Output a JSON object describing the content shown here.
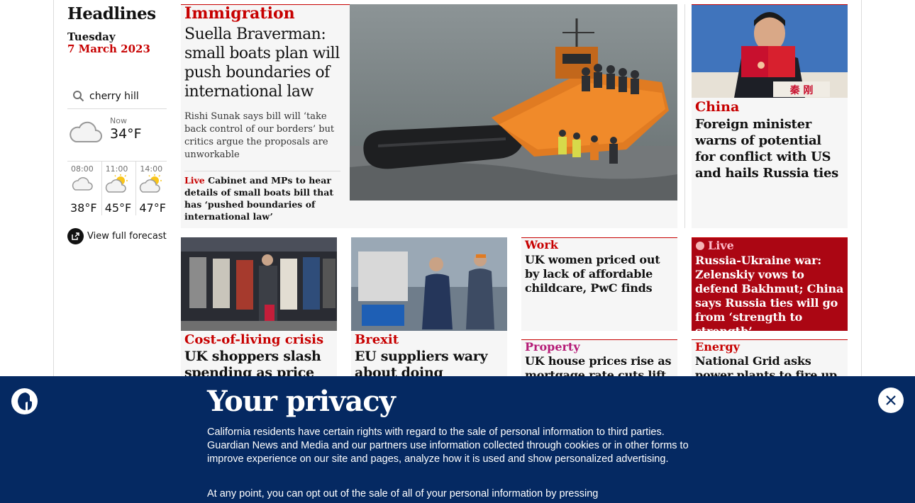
{
  "sidebar": {
    "title": "Headlines",
    "day": "Tuesday",
    "date": "7 March 2023",
    "location": "cherry hill",
    "weather": {
      "now_label": "Now",
      "now_temp": "34°F",
      "now_icon": "cloud-icon",
      "hours": [
        {
          "time": "08:00",
          "temp": "38°F",
          "icon": "cloud-icon"
        },
        {
          "time": "11:00",
          "temp": "45°F",
          "icon": "sun-cloud-icon"
        },
        {
          "time": "14:00",
          "temp": "47°F",
          "icon": "sun-cloud-icon"
        }
      ],
      "forecast_link": "View full forecast"
    }
  },
  "top_story": {
    "kicker": "Immigration",
    "headline": "Suella Braverman: small boats plan will push boundaries of international law",
    "standfirst": "Rishi Sunak says bill will ‘take back control of our borders’ but critics argue the proposals are unworkable",
    "live_label": "Live",
    "live_text": "Cabinet and MPs to hear details of small boats bill that has ‘pushed boundaries of international law’"
  },
  "china_story": {
    "kicker": "China",
    "headline": "Foreign minister warns of potential for conflict with US and hails Russia ties",
    "image_caption": "秦 刚"
  },
  "row2": [
    {
      "kicker": "Cost-of-living crisis",
      "headline": "UK shoppers slash spending as price rises"
    },
    {
      "kicker": "Brexit",
      "headline": "EU suppliers wary about doing business"
    },
    {
      "kicker": "Work",
      "headline": "UK women priced out by lack of affordable childcare, PwC finds"
    },
    {
      "live_label": "Live",
      "headline": "Russia-Ukraine war: Zelenskiy vows to defend Bakhmut; China says Russia ties will go from ‘strength to strength’"
    }
  ],
  "row3": [
    {
      "kicker": "Property",
      "headline": "UK house prices rise as mortgage rate cuts lift"
    },
    {
      "kicker": "Energy",
      "headline": "National Grid asks power plants to fire up before"
    }
  ],
  "privacy": {
    "title": "Your privacy",
    "text": "California residents have certain rights with regard to the sale of personal information to third parties. Guardian News and Media and our partners use information collected through cookies or in other forms to improve experience on our site and pages, analyze how it is used and show personalized advertising.",
    "text2": "At any point, you can opt out of the sale of all of your personal information by pressing"
  },
  "colors": {
    "news_red": "#c70000",
    "live_bg": "#ab0613",
    "banner_blue": "#052962",
    "card_bg": "#f6f6f6"
  }
}
